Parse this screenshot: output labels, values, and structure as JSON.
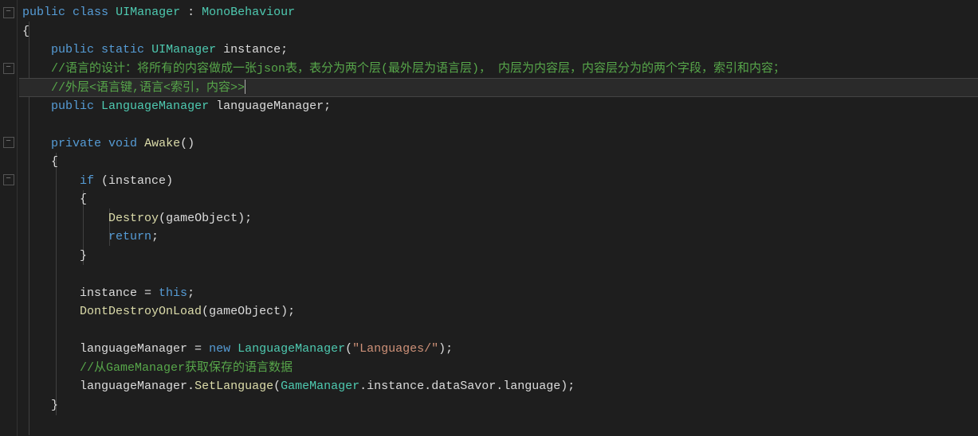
{
  "code": {
    "line1": {
      "kw1": "public",
      "kw2": "class",
      "type1": "UIManager",
      "colon": " : ",
      "type2": "MonoBehaviour"
    },
    "line2": "{",
    "line3": {
      "kw1": "public",
      "kw2": "static",
      "type": "UIManager",
      "name": "instance",
      "semi": ";"
    },
    "line4": "//语言的设计：将所有的内容做成一张json表，表分为两个层(最外层为语言层)， 内层为内容层，内容层分为的两个字段，索引和内容；",
    "line5": "//外层<语言键,语言<索引，内容>>",
    "line6": {
      "kw1": "public",
      "type": "LanguageManager",
      "name": "languageManager",
      "semi": ";"
    },
    "line8": {
      "kw1": "private",
      "kw2": "void",
      "method": "Awake",
      "parens": "()"
    },
    "line9": "{",
    "line10": {
      "kw": "if",
      "open": " (",
      "var": "instance",
      "close": ")"
    },
    "line11": "{",
    "line12": {
      "method": "Destroy",
      "open": "(",
      "arg": "gameObject",
      "close": ");"
    },
    "line13": {
      "kw": "return",
      "semi": ";"
    },
    "line14": "}",
    "line16": {
      "var": "instance",
      "eq": " = ",
      "kw": "this",
      "semi": ";"
    },
    "line17": {
      "method": "DontDestroyOnLoad",
      "open": "(",
      "arg": "gameObject",
      "close": ");"
    },
    "line19": {
      "var": "languageManager",
      "eq": " = ",
      "kw": "new",
      "type": "LanguageManager",
      "open": "(",
      "str": "\"Languages/\"",
      "close": ");"
    },
    "line20": "//从GameManager获取保存的语言数据",
    "line21": {
      "var1": "languageManager",
      "dot1": ".",
      "method": "SetLanguage",
      "open": "(",
      "type": "GameManager",
      "dot2": ".",
      "var2": "instance",
      "dot3": ".",
      "var3": "dataSavor",
      "dot4": ".",
      "var4": "language",
      "close": ");"
    },
    "line22": "}"
  },
  "fold_marks": {
    "minus": "−"
  }
}
